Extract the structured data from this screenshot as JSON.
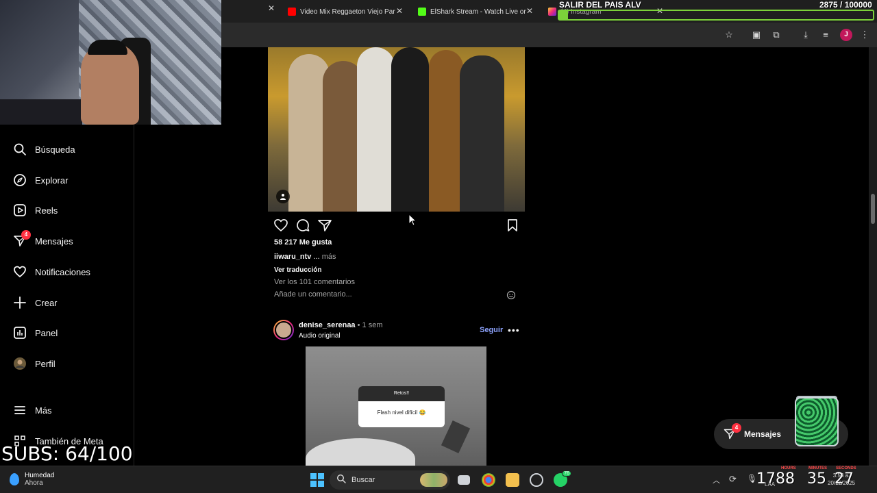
{
  "browser": {
    "tabs": [
      {
        "title": "Video Mix Reggaeton Viejo Par",
        "favicon": "youtube-icon",
        "color": "#ff0000"
      },
      {
        "title": "ElShark Stream - Watch Live on",
        "favicon": "kick-icon",
        "color": "#53fc18"
      },
      {
        "title": "(4) Instagram",
        "favicon": "instagram-icon",
        "color": "#e1306c"
      }
    ]
  },
  "overlay": {
    "title": "SALIR DEL PAIS ALV",
    "count": "2875 / 100000",
    "progress": 0.029,
    "color": "#7cd13a"
  },
  "sidebar": {
    "items": [
      {
        "label": "Búsqueda",
        "icon": "search-icon"
      },
      {
        "label": "Explorar",
        "icon": "compass-icon"
      },
      {
        "label": "Reels",
        "icon": "reels-icon"
      },
      {
        "label": "Mensajes",
        "icon": "messenger-icon",
        "badge": "4"
      },
      {
        "label": "Notificaciones",
        "icon": "heart-icon"
      },
      {
        "label": "Crear",
        "icon": "plus-icon"
      },
      {
        "label": "Panel",
        "icon": "chart-icon"
      },
      {
        "label": "Perfil",
        "icon": "profile-avatar"
      },
      {
        "label": "Más",
        "icon": "menu-icon"
      },
      {
        "label": "También de Meta",
        "icon": "meta-icon"
      }
    ]
  },
  "subs": "SUBS: 64/100",
  "post1": {
    "likes": "58 217 Me gusta",
    "username": "iiwaru_ntv",
    "ellipsis": "...",
    "more": "más",
    "translation": "Ver traducción",
    "comments": "Ver los 101 comentarios",
    "add_comment": "Añade un comentario..."
  },
  "post2": {
    "username": "denise_serenaa",
    "time": "• 1 sem",
    "audio": "Audio original",
    "follow": "Seguir",
    "video_card_title": "Retos!!",
    "video_card_text": "Flash nivel difícil 😂"
  },
  "floating": {
    "label": "Mensajes",
    "badge": "4"
  },
  "taskbar": {
    "weather_title": "Humedad",
    "weather_sub": "Ahora",
    "search": "Buscar",
    "whatsapp_badge": "76",
    "hours": "1788",
    "minutes": "35",
    "seconds": "27",
    "hours_label": "HOURS",
    "minutes_label": "MINUTES",
    "seconds_label": "SECONDS",
    "lang": "LAA",
    "time": "3:53 a.",
    "date": "20/12/2025"
  }
}
